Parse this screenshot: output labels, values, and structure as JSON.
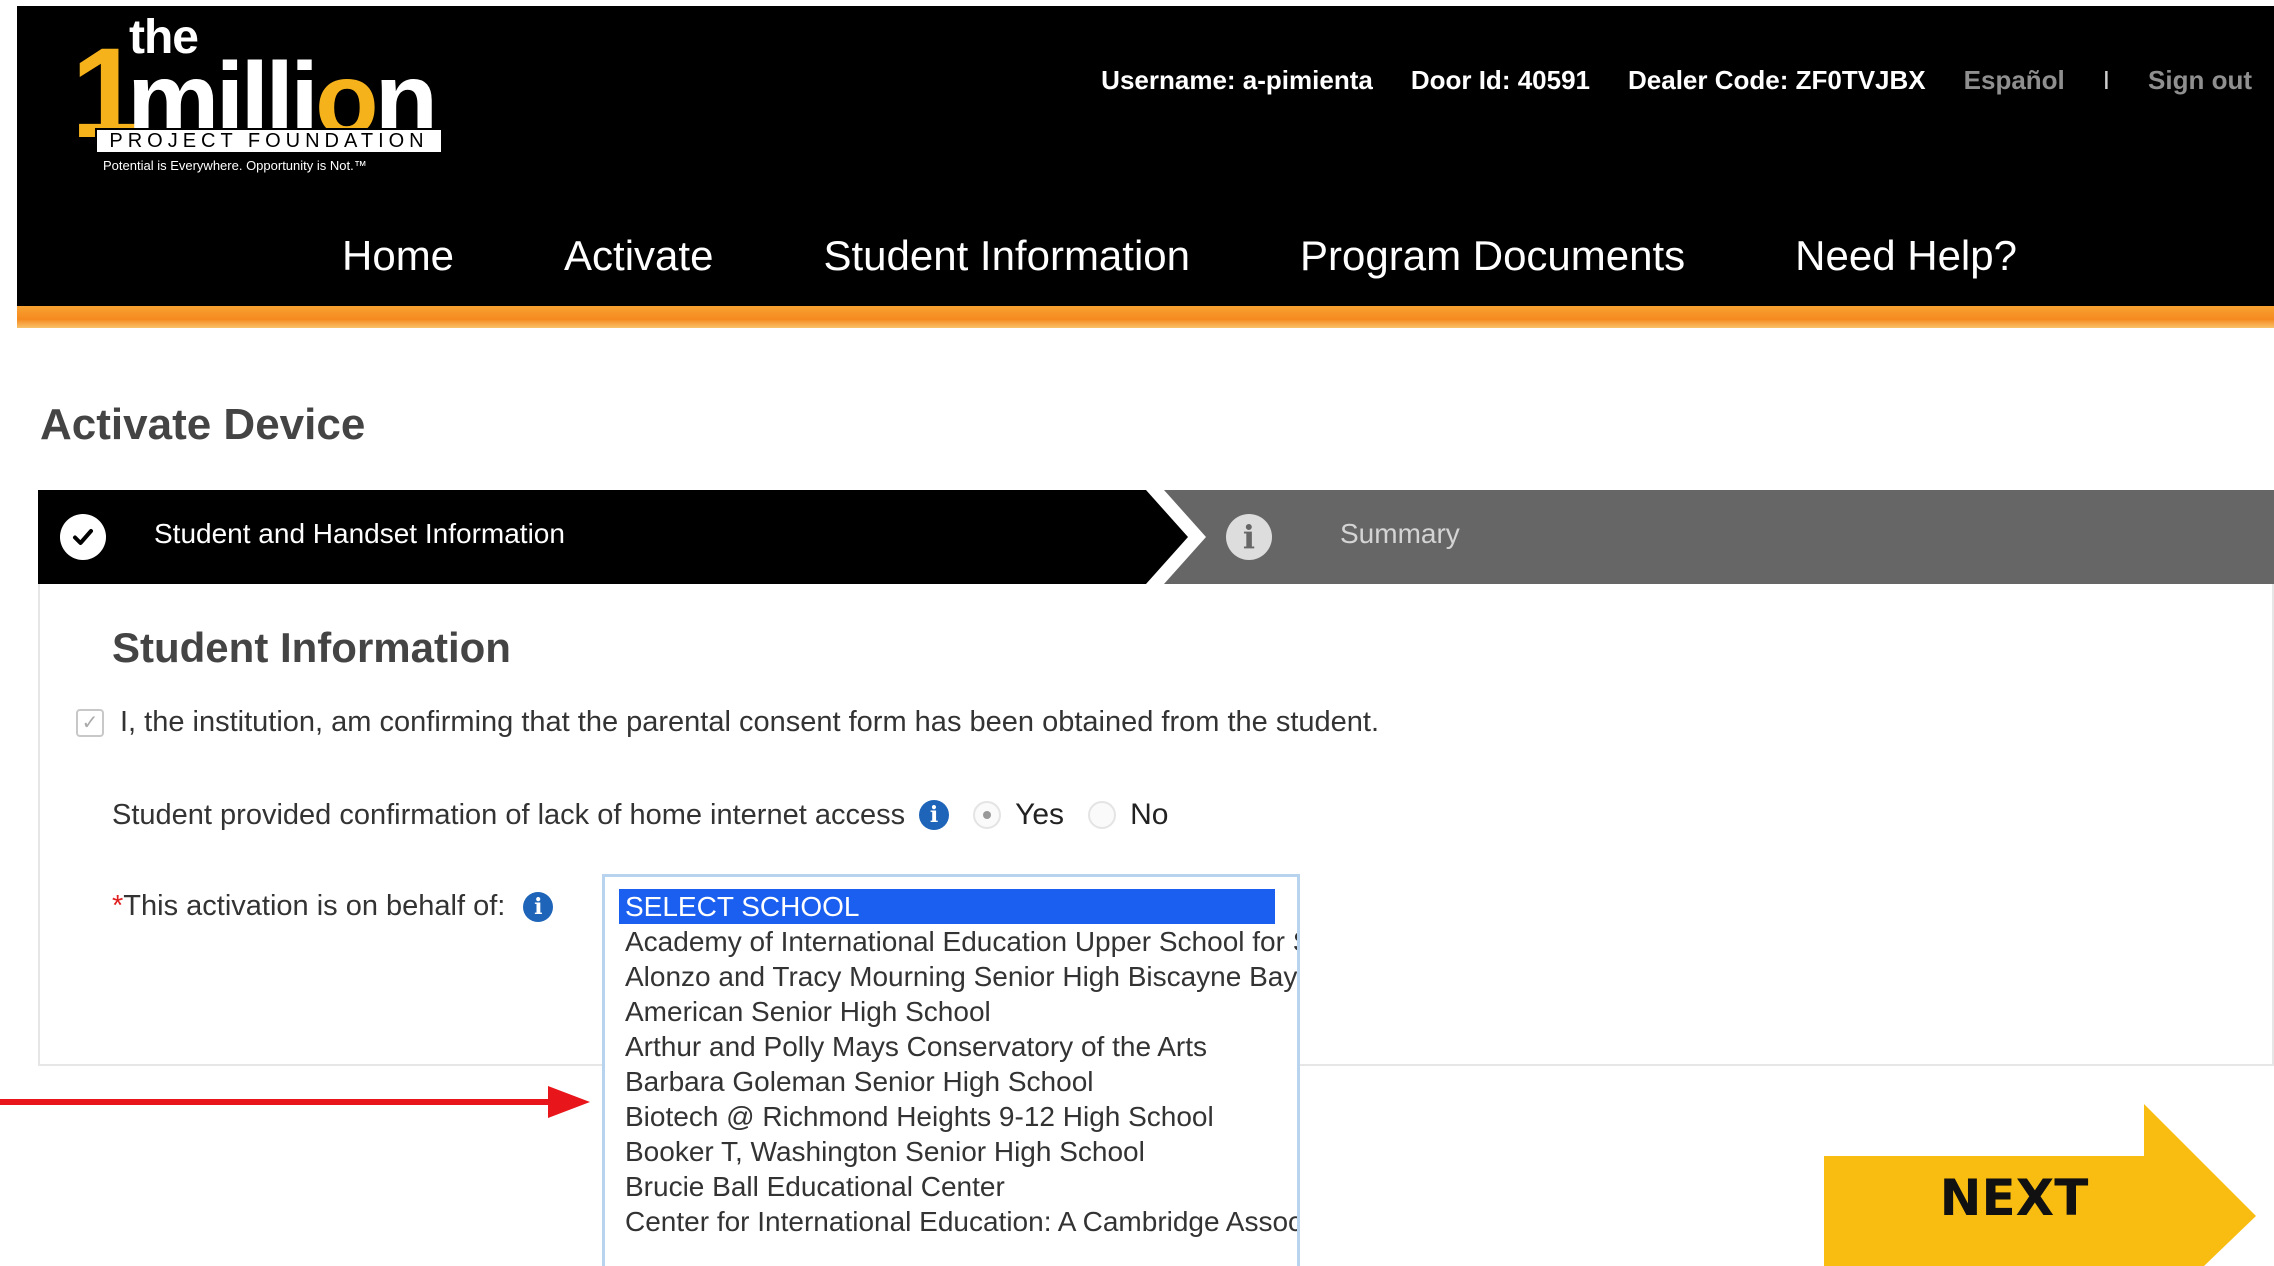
{
  "logo": {
    "the": "the",
    "one": "1",
    "million_prefix": "milli",
    "million_o": "o",
    "million_suffix": "n",
    "foundation": "PROJECT FOUNDATION",
    "tagline": "Potential is Everywhere. Opportunity is Not.™"
  },
  "userbar": {
    "username": "Username: a-pimienta",
    "door_id": "Door Id: 40591",
    "dealer_code": "Dealer Code: ZF0TVJBX",
    "language": "Español",
    "separator": "I",
    "sign_out": "Sign out"
  },
  "nav": [
    {
      "label": "Home"
    },
    {
      "label": "Activate"
    },
    {
      "label": "Student Information"
    },
    {
      "label": "Program Documents"
    },
    {
      "label": "Need Help?"
    }
  ],
  "page_title": "Activate Device",
  "steps": [
    {
      "label": "Student and Handset Information",
      "icon": "check-circle-icon"
    },
    {
      "label": "Summary",
      "icon": "info-circle-icon"
    }
  ],
  "form": {
    "section_title": "Student Information",
    "consent_text": "I, the institution, am confirming that the parental consent form has been obtained from the student.",
    "internet_question": "Student provided confirmation of lack of home internet access",
    "yes_label": "Yes",
    "no_label": "No",
    "required_mark": "*",
    "behalf_label": "This activation is on behalf of:",
    "school_options": [
      "SELECT SCHOOL",
      "Academy of International Education Upper School for S",
      "Alonzo and Tracy Mourning Senior High Biscayne Bay",
      "American Senior High School",
      "Arthur and Polly Mays Conservatory of the Arts",
      "Barbara Goleman Senior High School",
      "Biotech @ Richmond Heights 9-12 High School",
      "Booker T, Washington Senior High School",
      "Brucie Ball Educational Center",
      "Center for International Education: A Cambridge Assoc"
    ]
  },
  "next_label": "NEXT",
  "colors": {
    "header_bg": "#000000",
    "logo_gold": "#f6b21b",
    "accent_orange": "#f58a1f",
    "selected_option": "#1a5ff0",
    "info_blue": "#1e64b8",
    "annotation_red": "#e8161b",
    "next_yellow": "#f9bd12"
  }
}
